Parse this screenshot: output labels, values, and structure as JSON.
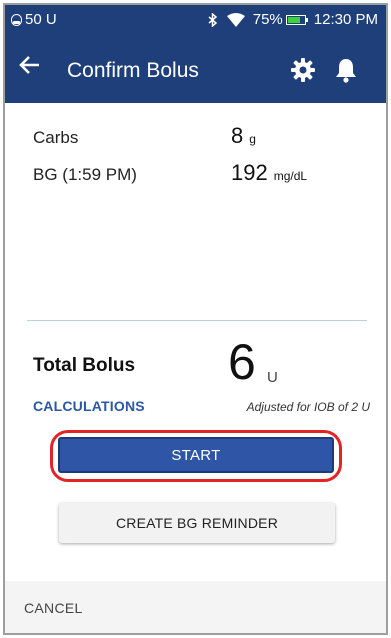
{
  "status_bar": {
    "insulin_remaining": "50 U",
    "battery_percent": "75%",
    "time": "12:30 PM",
    "icons": [
      "pod-icon",
      "bluetooth-icon",
      "wifi-icon",
      "battery-icon"
    ],
    "battery_level": 0.75
  },
  "header": {
    "title": "Confirm Bolus",
    "icons": [
      "back-arrow-icon",
      "gear-icon",
      "bell-icon"
    ]
  },
  "details": {
    "carbs_label": "Carbs",
    "carbs_value": "8",
    "carbs_unit": "g",
    "bg_label": "BG (1:59 PM)",
    "bg_value": "192",
    "bg_unit": "mg/dL"
  },
  "total": {
    "label": "Total Bolus",
    "value": "6",
    "unit": "U",
    "calculations_label": "CALCULATIONS",
    "adjusted_note": "Adjusted for IOB of 2 U"
  },
  "actions": {
    "start_label": "START",
    "reminder_label": "CREATE BG REMINDER",
    "cancel_label": "CANCEL"
  },
  "colors": {
    "header_bg": "#1e3f7a",
    "primary_button": "#2f56a6",
    "highlight_ring": "#e22424",
    "link": "#2a57a8",
    "battery_fill": "#3cd23c"
  }
}
